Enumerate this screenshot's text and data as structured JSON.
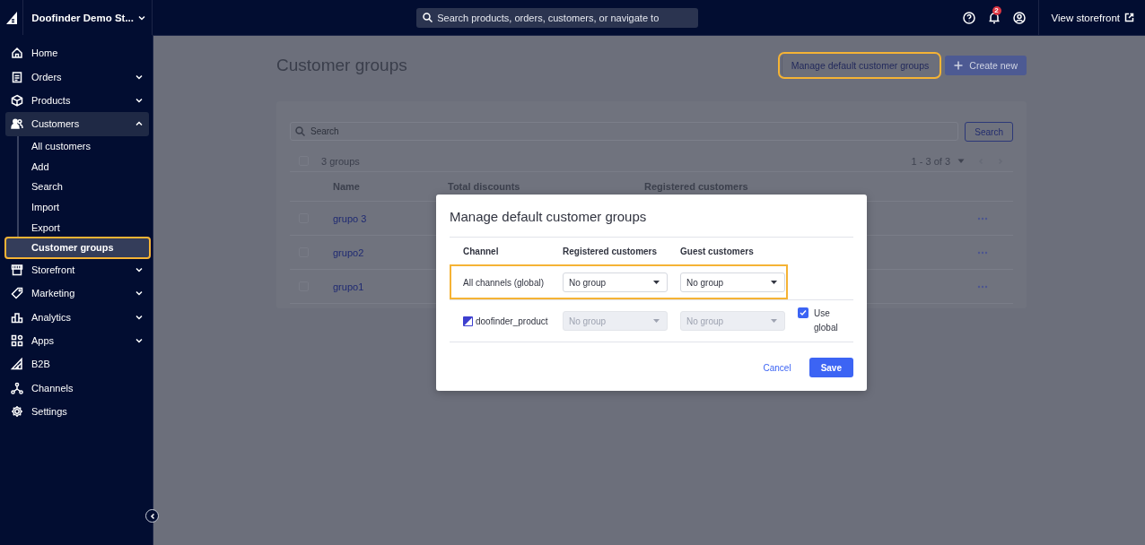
{
  "store": {
    "name": "Doofinder Demo St..."
  },
  "global_search": {
    "placeholder": "Search products, orders, customers, or navigate to"
  },
  "notifications": {
    "count": "2"
  },
  "view_storefront": "View storefront",
  "sidebar": {
    "items": [
      {
        "label": "Home",
        "expandable": false,
        "expanded": false
      },
      {
        "label": "Orders",
        "expandable": true,
        "expanded": false
      },
      {
        "label": "Products",
        "expandable": true,
        "expanded": false
      },
      {
        "label": "Customers",
        "expandable": true,
        "expanded": true,
        "children": [
          {
            "label": "All customers",
            "selected": false,
            "highlighted": false
          },
          {
            "label": "Add",
            "selected": false,
            "highlighted": false
          },
          {
            "label": "Search",
            "selected": false,
            "highlighted": false
          },
          {
            "label": "Import",
            "selected": false,
            "highlighted": false
          },
          {
            "label": "Export",
            "selected": false,
            "highlighted": false
          },
          {
            "label": "Customer groups",
            "selected": true,
            "highlighted": true
          }
        ]
      },
      {
        "label": "Storefront",
        "expandable": true,
        "expanded": false
      },
      {
        "label": "Marketing",
        "expandable": true,
        "expanded": false
      },
      {
        "label": "Analytics",
        "expandable": true,
        "expanded": false
      },
      {
        "label": "Apps",
        "expandable": true,
        "expanded": false
      },
      {
        "label": "B2B",
        "expandable": false,
        "expanded": false
      },
      {
        "label": "Channels",
        "expandable": false,
        "expanded": false
      },
      {
        "label": "Settings",
        "expandable": false,
        "expanded": false
      }
    ]
  },
  "page_title": "Customer groups",
  "actions": [
    {
      "label": "Manage default customer groups",
      "kind": "secondary",
      "highlighted": true
    },
    {
      "label": "Create new",
      "kind": "primary",
      "highlighted": false
    }
  ],
  "groups_card": {
    "search": {
      "placeholder": "Search"
    },
    "search_button": "Search",
    "select_all": {
      "checked": false
    },
    "count": "3 groups",
    "pagination": "1 - 3 of 3",
    "columns": [
      "Name",
      "Total discounts",
      "Registered customers"
    ],
    "rows": [
      {
        "name": "grupo 3",
        "checked": false
      },
      {
        "name": "grupo2",
        "checked": false
      },
      {
        "name": "grupo1",
        "checked": false
      }
    ]
  },
  "modal": {
    "title": "Manage default customer groups",
    "columns": [
      "Channel",
      "Registered customers",
      "Guest customers"
    ],
    "rows": [
      {
        "kind": "global",
        "channel": "All channels (global)",
        "registered": "No group",
        "guest": "No group",
        "disabled": false,
        "highlighted": true
      },
      {
        "kind": "channel",
        "channel": "doofinder_product",
        "registered": "No group",
        "guest": "No group",
        "disabled": true,
        "highlighted": false,
        "use_global": {
          "label": "Use global",
          "checked": true
        }
      }
    ],
    "cancel": "Cancel",
    "save": "Save"
  }
}
